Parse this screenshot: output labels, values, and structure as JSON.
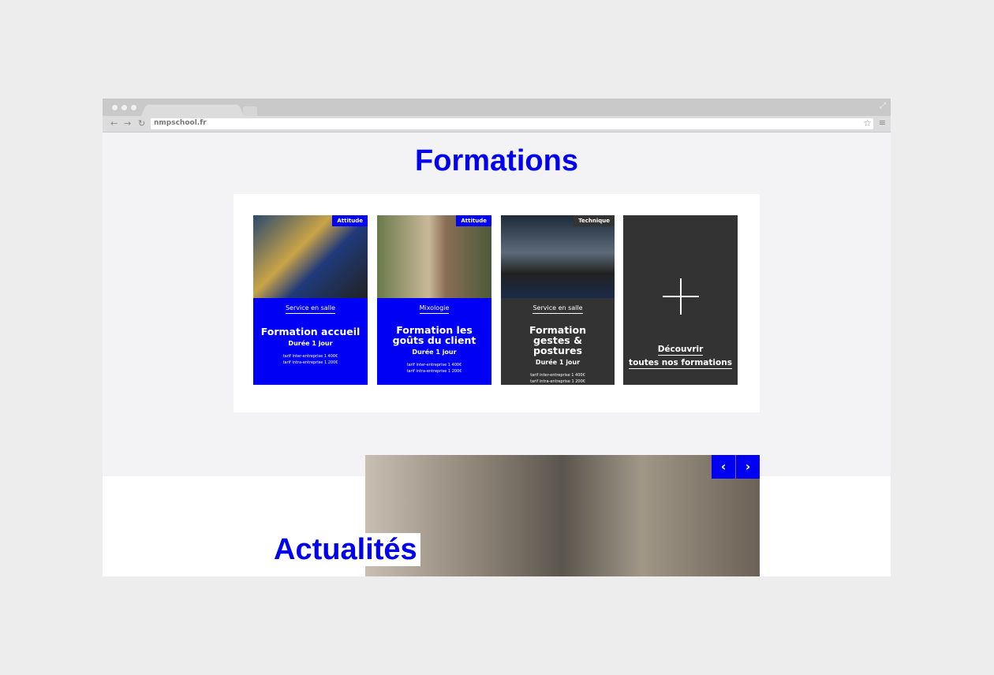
{
  "browser": {
    "url": "nmpschool.fr"
  },
  "formations": {
    "title": "Formations",
    "cards": [
      {
        "badge": "Attitude",
        "category": "Service en salle",
        "title": "Formation accueil",
        "duration": "Durée 1 jour",
        "price_inter": "tarif inter-entreprise 1 400€",
        "price_intra": "tarif intra-entreprise 1 200€"
      },
      {
        "badge": "Attitude",
        "category": "Mixologie",
        "title": "Formation les goûts du client",
        "duration": "Durée 1 jour",
        "price_inter": "tarif inter-entreprise 1 400€",
        "price_intra": "tarif intra-entreprise 1 200€"
      },
      {
        "badge": "Technique",
        "category": "Service en salle",
        "title": "Formation gestes & postures",
        "duration": "Durée 1 jour",
        "price_inter": "tarif inter-entreprise 1 400€",
        "price_intra": "tarif intra-entreprise 1 200€"
      }
    ],
    "discover_line1": "Découvrir",
    "discover_line2": "toutes nos formations"
  },
  "actualites": {
    "title": "Actualités",
    "prev": "‹",
    "next": "›"
  },
  "colors": {
    "accent": "#0000f5",
    "dark_card": "#333333"
  }
}
